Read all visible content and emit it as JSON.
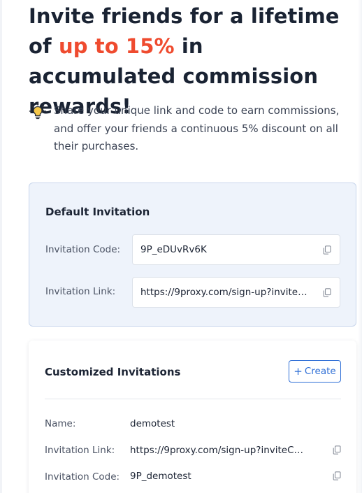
{
  "hero": {
    "title_part1": "Invite friends for a lifetime of",
    "title_accent": "up to 15%",
    "title_part2": " in accumulated commission rewards!",
    "accent_color": "#ef4b2f"
  },
  "tip": {
    "icon": "lightbulb-icon",
    "text": "Share your unique link and code to earn commissions, and offer your friends a continuous 5% discount on all their purchases."
  },
  "default_invitation": {
    "heading": "Default Invitation",
    "code_label": "Invitation Code:",
    "code_value": "9P_eDUvRv6K",
    "link_label": "Invitation Link:",
    "link_value": "https://9proxy.com/sign-up?invite…",
    "copy_icon": "copy-icon"
  },
  "customized_invitations": {
    "heading": "Customized Invitations",
    "create_label": "Create",
    "create_color": "#2f6fd6",
    "items": [
      {
        "name_label": "Name:",
        "name_value": "demotest",
        "link_label": "Invitation Link:",
        "link_value": "https://9proxy.com/sign-up?inviteC…",
        "code_label": "Invitation Code:",
        "code_value": "9P_demotest"
      }
    ]
  }
}
